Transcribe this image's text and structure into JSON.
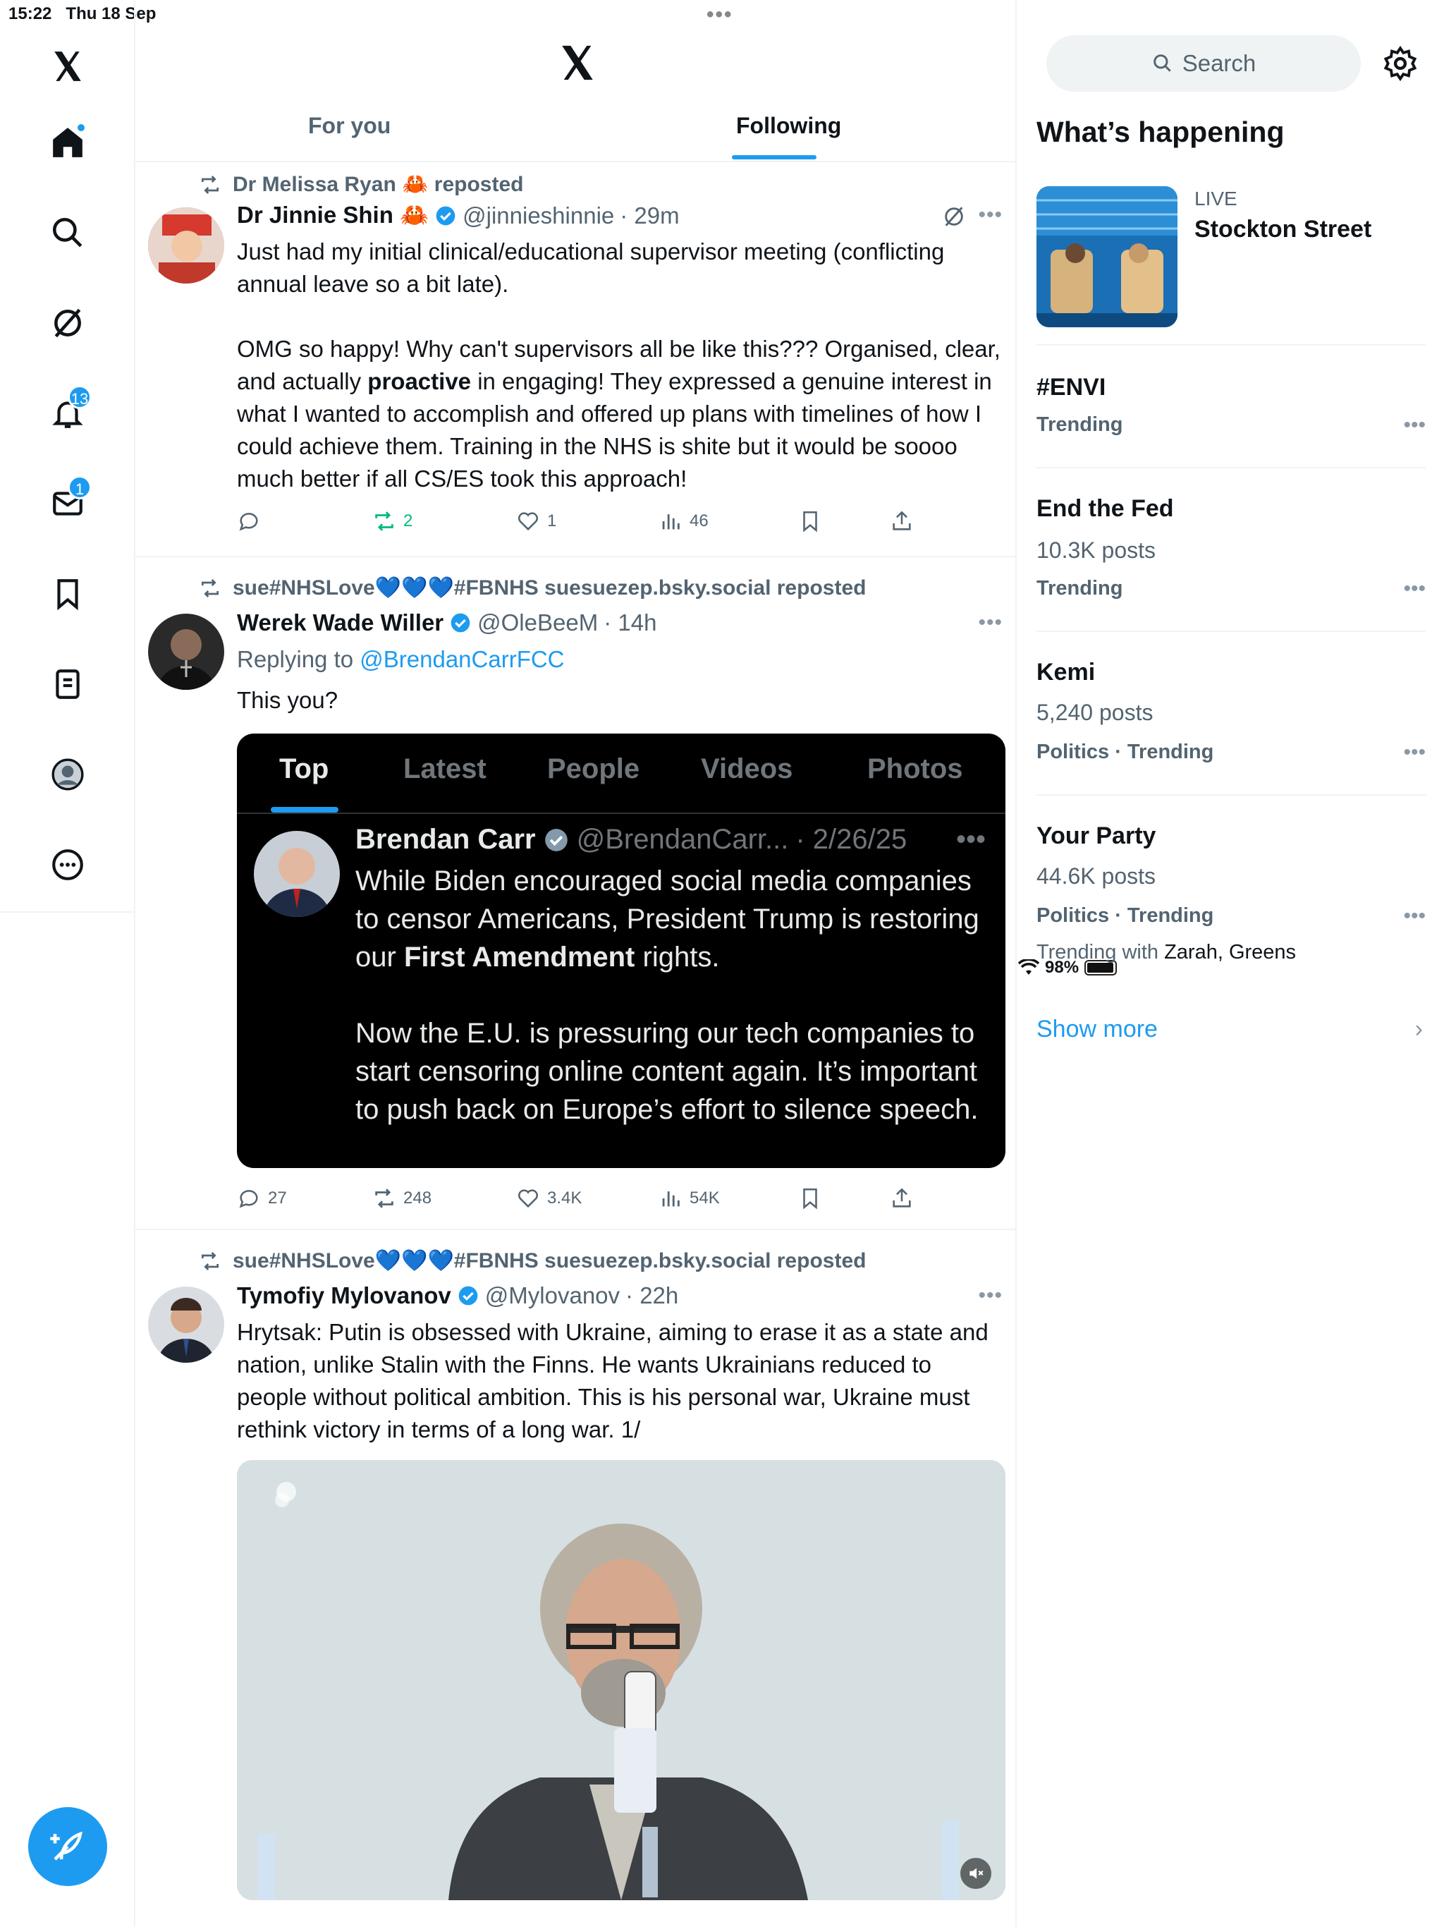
{
  "status_bar": {
    "time": "15:22",
    "date": "Thu 18 Sep",
    "battery": "98%"
  },
  "left_nav": {
    "notifications_badge": "13",
    "messages_badge": "1"
  },
  "header": {
    "tabs": [
      {
        "label": "For you",
        "active": false
      },
      {
        "label": "Following",
        "active": true
      }
    ]
  },
  "posts": [
    {
      "reposted_by": "Dr Melissa Ryan 🦀 reposted",
      "name": "Dr Jinnie Shin 🦀",
      "handle": "@jinnieshinnie",
      "time": "· 29m",
      "text_a": "Just had my initial clinical/educational supervisor meeting (conflicting annual leave so a bit late).\n\nOMG so happy! Why can't supervisors all be like this??? Organised, clear, and actually ",
      "text_bold": "proactive",
      "text_b": " in engaging! They expressed a genuine interest in what I wanted to accomplish and offered up plans with timelines of how I could achieve them. Training in the NHS is shite but it would be soooo much better if all CS/ES took this approach!",
      "replies": "",
      "reposts": "2",
      "likes": "1",
      "views": "46"
    },
    {
      "reposted_by": "sue#NHSLove💙💙💙#FBNHS suesuezep.bsky.social reposted",
      "name": "Werek Wade Willer",
      "handle": "@OleBeeM",
      "time": "· 14h",
      "replying_prefix": "Replying to ",
      "replying_to": "@BrendanCarrFCC",
      "text": "This you?",
      "embed": {
        "tabs": [
          "Top",
          "Latest",
          "People",
          "Videos",
          "Photos"
        ],
        "name": "Brendan Carr",
        "handle": "@BrendanCarr...",
        "time": "· 2/26/25",
        "text_a": "While Biden encouraged social media companies to censor Americans, President Trump is restoring our ",
        "text_bold": "First Amendment",
        "text_b": " rights.\n\nNow the E.U. is pressuring our tech companies to start censoring online content again. It’s important to push back on Europe’s effort to silence speech."
      },
      "replies": "27",
      "reposts": "248",
      "likes": "3.4K",
      "views": "54K"
    },
    {
      "reposted_by": "sue#NHSLove💙💙💙#FBNHS suesuezep.bsky.social reposted",
      "name": "Tymofiy Mylovanov",
      "handle": "@Mylovanov",
      "time": "· 22h",
      "text": "Hrytsak: Putin is obsessed with Ukraine, aiming to erase it as a state and nation, unlike Stalin with the Finns. He wants Ukrainians reduced to people without political ambition. This is his personal war, Ukraine must rethink victory in terms of a long war. 1/"
    }
  ],
  "right": {
    "search_placeholder": "Search",
    "title": "What’s happening",
    "live": {
      "label": "LIVE",
      "title": "Stockton Street"
    },
    "trends": [
      {
        "title": "#ENVI",
        "posts": "",
        "meta": "Trending"
      },
      {
        "title": "End the Fed",
        "posts": "10.3K posts",
        "meta": "Trending"
      },
      {
        "title": "Kemi",
        "posts": "5,240 posts",
        "meta": "Politics · Trending"
      },
      {
        "title": "Your Party",
        "posts": "44.6K posts",
        "meta": "Politics · Trending",
        "with_prefix": "Trending with ",
        "with_names": "Zarah, Greens"
      }
    ],
    "show_more": "Show more"
  },
  "colors": {
    "accent": "#1d9bf0",
    "repost_green": "#00ba7c",
    "muted": "#536471"
  }
}
